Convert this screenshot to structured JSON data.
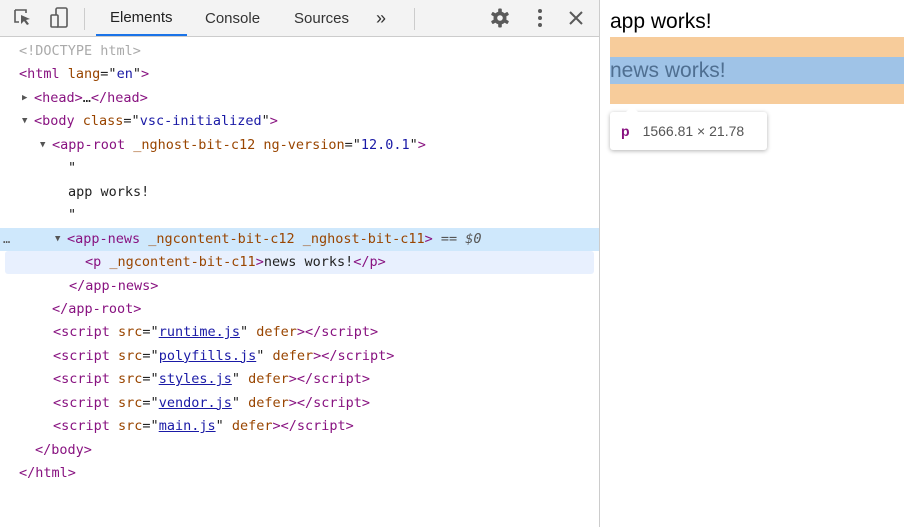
{
  "toolbar": {
    "tabs": [
      {
        "label": "Elements",
        "active": true
      },
      {
        "label": "Console"
      },
      {
        "label": "Sources"
      }
    ],
    "more": "»",
    "icons": [
      "inspect-icon",
      "device-toggle-icon",
      "settings-icon",
      "more-vert-icon",
      "close-icon"
    ]
  },
  "tree": [
    {
      "indent": 19,
      "tokens": [
        {
          "c": "doc",
          "t": "<!DOCTYPE html>"
        }
      ]
    },
    {
      "indent": 19,
      "tokens": [
        {
          "c": "tag",
          "t": "<html "
        },
        {
          "c": "attr",
          "t": "lang"
        },
        {
          "c": "punct",
          "t": "=\""
        },
        {
          "c": "val",
          "t": "en"
        },
        {
          "c": "punct",
          "t": "\""
        },
        {
          "c": "tag",
          "t": ">"
        }
      ]
    },
    {
      "indent": 34,
      "arrow": "▶",
      "tokens": [
        {
          "c": "tag",
          "t": "<head>"
        },
        {
          "c": "punct",
          "t": "…"
        },
        {
          "c": "tag",
          "t": "</head>"
        }
      ]
    },
    {
      "indent": 34,
      "arrow": "▼",
      "tokens": [
        {
          "c": "tag",
          "t": "<body "
        },
        {
          "c": "attr",
          "t": "class"
        },
        {
          "c": "punct",
          "t": "=\""
        },
        {
          "c": "val",
          "t": "vsc-initialized"
        },
        {
          "c": "punct",
          "t": "\""
        },
        {
          "c": "tag",
          "t": ">"
        }
      ]
    },
    {
      "indent": 52,
      "arrow": "▼",
      "tokens": [
        {
          "c": "tag",
          "t": "<app-root "
        },
        {
          "c": "attr",
          "t": "_nghost-bit-c12 ng-version"
        },
        {
          "c": "punct",
          "t": "=\""
        },
        {
          "c": "val",
          "t": "12.0.1"
        },
        {
          "c": "punct",
          "t": "\""
        },
        {
          "c": "tag",
          "t": ">"
        }
      ]
    },
    {
      "indent": 68,
      "tokens": [
        {
          "c": "text",
          "t": "\""
        }
      ]
    },
    {
      "indent": 68,
      "tokens": [
        {
          "c": "text",
          "t": "app works!"
        }
      ]
    },
    {
      "indent": 68,
      "tokens": [
        {
          "c": "text",
          "t": "\""
        }
      ]
    },
    {
      "indent": 67,
      "arrow": "▼",
      "selected": true,
      "tokens": [
        {
          "c": "tag",
          "t": "<app-news "
        },
        {
          "c": "attr",
          "t": "_ngcontent-bit-c12 _nghost-bit-c11"
        },
        {
          "c": "tag",
          "t": ">"
        },
        {
          "c": "eq",
          "t": " == $0"
        }
      ]
    },
    {
      "indent": 85,
      "hover": true,
      "tokens": [
        {
          "c": "tag",
          "t": "<p "
        },
        {
          "c": "attr",
          "t": "_ngcontent-bit-c11"
        },
        {
          "c": "tag",
          "t": ">"
        },
        {
          "c": "text",
          "t": "news works!"
        },
        {
          "c": "tag",
          "t": "</p>"
        }
      ]
    },
    {
      "indent": 69,
      "tokens": [
        {
          "c": "tag",
          "t": "</app-news>"
        }
      ]
    },
    {
      "indent": 52,
      "tokens": [
        {
          "c": "tag",
          "t": "</app-root>"
        }
      ]
    },
    {
      "indent": 53,
      "tokens": [
        {
          "c": "tag",
          "t": "<script "
        },
        {
          "c": "attr",
          "t": "src"
        },
        {
          "c": "punct",
          "t": "=\""
        },
        {
          "c": "link",
          "t": "runtime.js"
        },
        {
          "c": "punct",
          "t": "\" "
        },
        {
          "c": "attr",
          "t": "defer"
        },
        {
          "c": "tag",
          "t": "></script>"
        }
      ]
    },
    {
      "indent": 53,
      "tokens": [
        {
          "c": "tag",
          "t": "<script "
        },
        {
          "c": "attr",
          "t": "src"
        },
        {
          "c": "punct",
          "t": "=\""
        },
        {
          "c": "link",
          "t": "polyfills.js"
        },
        {
          "c": "punct",
          "t": "\" "
        },
        {
          "c": "attr",
          "t": "defer"
        },
        {
          "c": "tag",
          "t": "></script>"
        }
      ]
    },
    {
      "indent": 53,
      "tokens": [
        {
          "c": "tag",
          "t": "<script "
        },
        {
          "c": "attr",
          "t": "src"
        },
        {
          "c": "punct",
          "t": "=\""
        },
        {
          "c": "link",
          "t": "styles.js"
        },
        {
          "c": "punct",
          "t": "\" "
        },
        {
          "c": "attr",
          "t": "defer"
        },
        {
          "c": "tag",
          "t": "></script>"
        }
      ]
    },
    {
      "indent": 53,
      "tokens": [
        {
          "c": "tag",
          "t": "<script "
        },
        {
          "c": "attr",
          "t": "src"
        },
        {
          "c": "punct",
          "t": "=\""
        },
        {
          "c": "link",
          "t": "vendor.js"
        },
        {
          "c": "punct",
          "t": "\" "
        },
        {
          "c": "attr",
          "t": "defer"
        },
        {
          "c": "tag",
          "t": "></script>"
        }
      ]
    },
    {
      "indent": 53,
      "tokens": [
        {
          "c": "tag",
          "t": "<script "
        },
        {
          "c": "attr",
          "t": "src"
        },
        {
          "c": "punct",
          "t": "=\""
        },
        {
          "c": "link",
          "t": "main.js"
        },
        {
          "c": "punct",
          "t": "\" "
        },
        {
          "c": "attr",
          "t": "defer"
        },
        {
          "c": "tag",
          "t": "></script>"
        }
      ]
    },
    {
      "indent": 35,
      "tokens": [
        {
          "c": "tag",
          "t": "</body>"
        }
      ]
    },
    {
      "indent": 19,
      "tokens": [
        {
          "c": "tag",
          "t": "</html>"
        }
      ]
    }
  ],
  "selected_dots": "…",
  "page": {
    "app_text": "app works!",
    "news_text": "news works!",
    "tooltip": {
      "tag": "p",
      "size": "1566.81 × 21.78"
    }
  },
  "colors": {
    "margin": "#f7cc9b",
    "content": "#9fc3e7",
    "accent": "#1a73e8"
  }
}
